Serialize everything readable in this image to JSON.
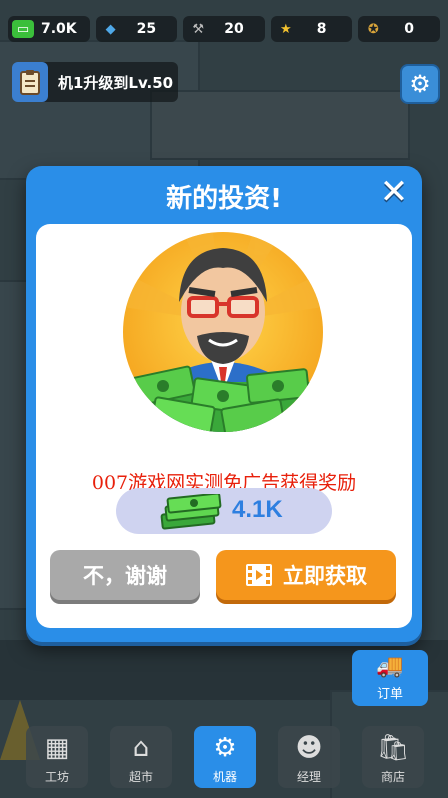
{
  "resources": [
    {
      "icon": "cash-icon",
      "value": "7.0K",
      "color": "#3bbf3b"
    },
    {
      "icon": "gem-icon",
      "value": "25",
      "color": "#4fa8e8"
    },
    {
      "icon": "hammer-icon",
      "value": "20",
      "color": "#9a9a9a"
    },
    {
      "icon": "star-icon",
      "value": "8",
      "color": "#f2c12e"
    },
    {
      "icon": "badge-icon",
      "value": "0",
      "color": "#d8a43a"
    }
  ],
  "upgrade_banner": {
    "text": "机1升级到Lv.50"
  },
  "dialog": {
    "title": "新的投资!",
    "promo_text": "007游戏网实测免广告获得奖励",
    "reward_value": "4.1K",
    "decline_label": "不，谢谢",
    "accept_label": "立即获取"
  },
  "order_label": "订单",
  "nav": [
    {
      "label": "工坊",
      "icon": "workshop-icon"
    },
    {
      "label": "超市",
      "icon": "market-icon"
    },
    {
      "label": "机器",
      "icon": "machine-icon",
      "active": true
    },
    {
      "label": "经理",
      "icon": "manager-icon"
    },
    {
      "label": "商店",
      "icon": "shop-icon"
    }
  ],
  "colors": {
    "dialog_blue": "#2a8ee8",
    "accept_orange": "#f5961c",
    "decline_grey": "#a9a9a9",
    "reward_text": "#2e7fe0"
  }
}
